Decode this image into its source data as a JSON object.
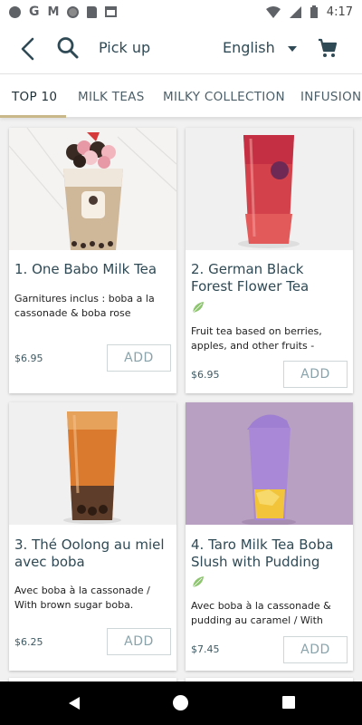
{
  "status_bar": {
    "time": "4:17",
    "icons": [
      "record-dot-icon",
      "google-icon",
      "gmail-icon",
      "sync-icon",
      "sd-card-icon",
      "calendar-icon",
      "wifi-icon",
      "signal-icon",
      "battery-icon"
    ],
    "g_glyph": "G",
    "m_glyph": "M"
  },
  "header": {
    "pickup_label": "Pick up",
    "language": "English",
    "icons": [
      "back-arrow-icon",
      "search-icon",
      "dropdown-caret-icon",
      "cart-icon"
    ]
  },
  "tabs": [
    {
      "label": "TOP 10",
      "active": true
    },
    {
      "label": "MILK TEAS",
      "active": false
    },
    {
      "label": "MILKY COLLECTION",
      "active": false
    },
    {
      "label": "INFUSION",
      "active": false
    }
  ],
  "colors": {
    "accent_underline": "#c9b98a",
    "title_text": "#2f4a55",
    "veg_leaf": "#8cc56e"
  },
  "products": [
    {
      "title": "1. One Babo Milk Tea",
      "description": "Garnitures inclus : boba a la cassonade & boba rose",
      "price": "$6.95",
      "add_label": "ADD",
      "veg": false
    },
    {
      "title": "2. German Black Forest Flower Tea",
      "description": "Fruit tea based on berries, apples, and other fruits -",
      "price": "$6.95",
      "add_label": "ADD",
      "veg": true
    },
    {
      "title": "3. Thé Oolong au miel avec boba",
      "description": "Avec boba à la cassonade / With brown sugar boba.",
      "price": "$6.25",
      "add_label": "ADD",
      "veg": false
    },
    {
      "title": "4. Taro Milk Tea Boba Slush with Pudding",
      "description": "Avec boba à la cassonade & pudding au caramel / With",
      "price": "$7.45",
      "add_label": "ADD",
      "veg": true
    }
  ],
  "nav_bar": {
    "icons": [
      "nav-back-icon",
      "nav-home-icon",
      "nav-recents-icon"
    ]
  }
}
